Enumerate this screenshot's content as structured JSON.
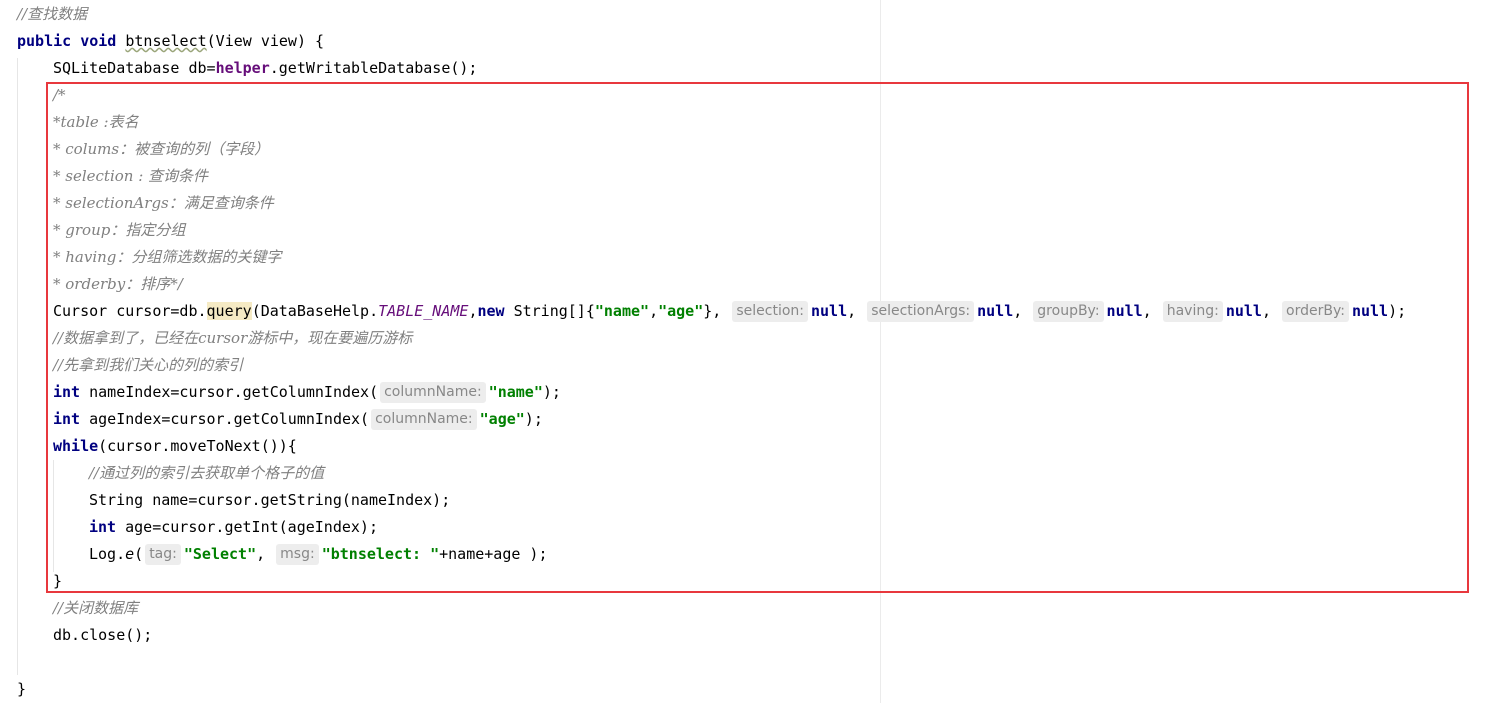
{
  "editor": {
    "language": "Java",
    "annotation": {
      "color": "#e8383d"
    },
    "lines": [
      {
        "indent": 0,
        "tokens": [
          {
            "t": "//查找数据",
            "c": "cmt"
          }
        ]
      },
      {
        "indent": 0,
        "tokens": [
          {
            "t": "public",
            "c": "kw"
          },
          {
            "t": " "
          },
          {
            "t": "void",
            "c": "kw"
          },
          {
            "t": " "
          },
          {
            "t": "btnselect",
            "c": "uline"
          },
          {
            "t": "(View view) {"
          }
        ]
      },
      {
        "indent": 1,
        "tokens": [
          {
            "t": "SQLiteDatabase db="
          },
          {
            "t": "helper",
            "c": "fld"
          },
          {
            "t": ".getWritableDatabase();"
          }
        ]
      },
      {
        "indent": 1,
        "tokens": [
          {
            "t": "/*",
            "c": "cmt"
          }
        ]
      },
      {
        "indent": 1,
        "tokens": [
          {
            "t": "*table :表名",
            "c": "cmt"
          }
        ]
      },
      {
        "indent": 1,
        "tokens": [
          {
            "t": "* colums：被查询的列（字段）",
            "c": "cmt"
          }
        ]
      },
      {
        "indent": 1,
        "tokens": [
          {
            "t": "* selection : 查询条件",
            "c": "cmt"
          }
        ]
      },
      {
        "indent": 1,
        "tokens": [
          {
            "t": "* selectionArgs：满足查询条件",
            "c": "cmt"
          }
        ]
      },
      {
        "indent": 1,
        "tokens": [
          {
            "t": "* group：指定分组",
            "c": "cmt"
          }
        ]
      },
      {
        "indent": 1,
        "tokens": [
          {
            "t": "* having：分组筛选数据的关键字",
            "c": "cmt"
          }
        ]
      },
      {
        "indent": 1,
        "tokens": [
          {
            "t": "* orderby：排序*/",
            "c": "cmt"
          }
        ]
      },
      {
        "indent": 1,
        "tokens": [
          {
            "t": "Cursor cursor=db."
          },
          {
            "t": "query",
            "c": "hl"
          },
          {
            "t": "(DataBaseHelp."
          },
          {
            "t": "TABLE_NAME",
            "c": "cnst"
          },
          {
            "t": ","
          },
          {
            "t": "new",
            "c": "kw"
          },
          {
            "t": " String[]{"
          },
          {
            "t": "\"name\"",
            "c": "str"
          },
          {
            "t": ","
          },
          {
            "t": "\"age\"",
            "c": "str"
          },
          {
            "t": "}, "
          },
          {
            "t": "selection:",
            "c": "hint"
          },
          {
            "t": "null",
            "c": "kw"
          },
          {
            "t": ", "
          },
          {
            "t": "selectionArgs:",
            "c": "hint"
          },
          {
            "t": "null",
            "c": "kw"
          },
          {
            "t": ", "
          },
          {
            "t": "groupBy:",
            "c": "hint"
          },
          {
            "t": "null",
            "c": "kw"
          },
          {
            "t": ", "
          },
          {
            "t": "having:",
            "c": "hint"
          },
          {
            "t": "null",
            "c": "kw"
          },
          {
            "t": ", "
          },
          {
            "t": "orderBy:",
            "c": "hint"
          },
          {
            "t": "null",
            "c": "kw"
          },
          {
            "t": ");"
          }
        ]
      },
      {
        "indent": 1,
        "tokens": [
          {
            "t": "//数据拿到了，已经在cursor游标中，现在要遍历游标",
            "c": "cmt"
          }
        ]
      },
      {
        "indent": 1,
        "tokens": [
          {
            "t": "//先拿到我们关心的列的索引",
            "c": "cmt"
          }
        ]
      },
      {
        "indent": 1,
        "tokens": [
          {
            "t": "int",
            "c": "kw"
          },
          {
            "t": " nameIndex=cursor.getColumnIndex("
          },
          {
            "t": "columnName:",
            "c": "hint"
          },
          {
            "t": "\"name\"",
            "c": "str"
          },
          {
            "t": ");"
          }
        ]
      },
      {
        "indent": 1,
        "tokens": [
          {
            "t": "int",
            "c": "kw"
          },
          {
            "t": " ageIndex=cursor.getColumnIndex("
          },
          {
            "t": "columnName:",
            "c": "hint"
          },
          {
            "t": "\"age\"",
            "c": "str"
          },
          {
            "t": ");"
          }
        ]
      },
      {
        "indent": 1,
        "tokens": [
          {
            "t": "while",
            "c": "kw"
          },
          {
            "t": "(cursor.moveToNext()){"
          }
        ]
      },
      {
        "indent": 2,
        "tokens": [
          {
            "t": "//通过列的索引去获取单个格子的值",
            "c": "cmt"
          }
        ]
      },
      {
        "indent": 2,
        "tokens": [
          {
            "t": "String name=cursor.getString(nameIndex);"
          }
        ]
      },
      {
        "indent": 2,
        "tokens": [
          {
            "t": "int",
            "c": "kw"
          },
          {
            "t": " age=cursor.getInt(ageIndex);"
          }
        ]
      },
      {
        "indent": 2,
        "tokens": [
          {
            "t": "Log."
          },
          {
            "t": "e",
            "c": "ital"
          },
          {
            "t": "("
          },
          {
            "t": "tag:",
            "c": "hint"
          },
          {
            "t": "\"Select\"",
            "c": "str"
          },
          {
            "t": ", "
          },
          {
            "t": "msg:",
            "c": "hint"
          },
          {
            "t": "\"btnselect: \"",
            "c": "str"
          },
          {
            "t": "+name+age );"
          }
        ]
      },
      {
        "indent": 1,
        "tokens": [
          {
            "t": "}"
          }
        ]
      },
      {
        "indent": 1,
        "tokens": [
          {
            "t": "//关闭数据库",
            "c": "cmt"
          }
        ]
      },
      {
        "indent": 1,
        "tokens": [
          {
            "t": "db.close();"
          }
        ]
      },
      {
        "indent": 0,
        "tokens": []
      },
      {
        "indent": 0,
        "tokens": [
          {
            "t": "}"
          }
        ]
      }
    ]
  }
}
